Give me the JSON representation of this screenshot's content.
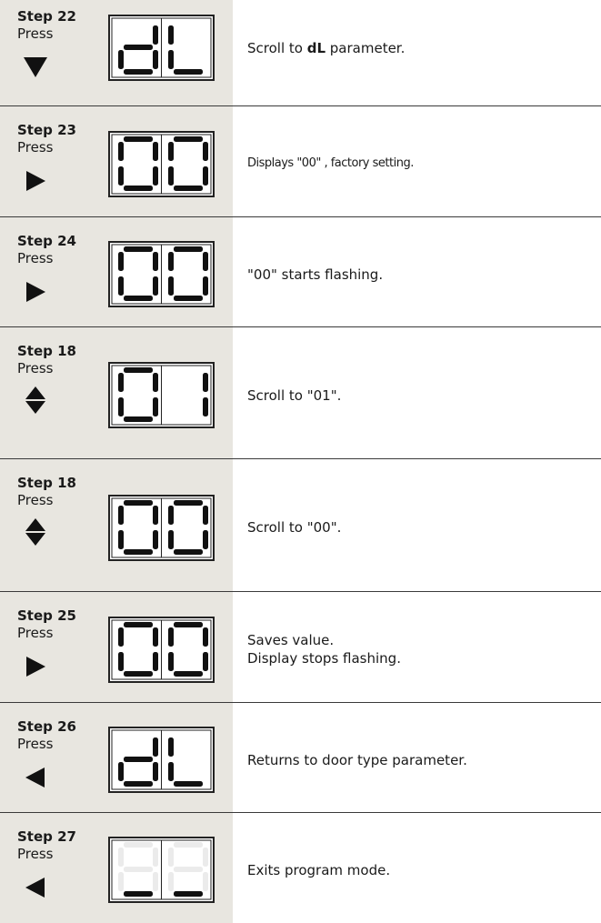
{
  "press_label": "Press",
  "rows": [
    {
      "step": "Step 22",
      "arrow": "down-arrow-icon",
      "display": [
        "d",
        "L"
      ],
      "desc_lines": [
        [
          "Scroll to ",
          "dL",
          " parameter."
        ]
      ]
    },
    {
      "step": "Step 23",
      "arrow": "right-arrow-icon",
      "display": [
        "0",
        "0"
      ],
      "desc_lines": [
        [
          "Displays \"00\" , factory setting."
        ]
      ]
    },
    {
      "step": "Step 24",
      "arrow": "right-arrow-icon",
      "display": [
        "0",
        "0"
      ],
      "desc_lines": [
        [
          "\"00\" starts flashing."
        ]
      ]
    },
    {
      "step": "Step 18",
      "arrow": "up-down-arrow-icon",
      "display": [
        "0",
        "1"
      ],
      "desc_lines": [
        [
          "Scroll to \"01\"."
        ]
      ]
    },
    {
      "step": "Step 18",
      "arrow": "up-down-arrow-icon",
      "display": [
        "0",
        "0"
      ],
      "desc_lines": [
        [
          "Scroll to \"00\"."
        ]
      ]
    },
    {
      "step": "Step 25",
      "arrow": "right-arrow-icon",
      "display": [
        "0",
        "0"
      ],
      "desc_lines": [
        [
          "Saves value."
        ],
        [
          "Display stops flashing."
        ]
      ]
    },
    {
      "step": "Step 26",
      "arrow": "left-arrow-icon",
      "display": [
        "d",
        "L"
      ],
      "desc_lines": [
        [
          "Returns to door type parameter."
        ]
      ]
    },
    {
      "step": "Step 27",
      "arrow": "left-arrow-icon",
      "display": [
        "_",
        "_"
      ],
      "desc_lines": [
        [
          "Exits program mode."
        ]
      ]
    }
  ]
}
